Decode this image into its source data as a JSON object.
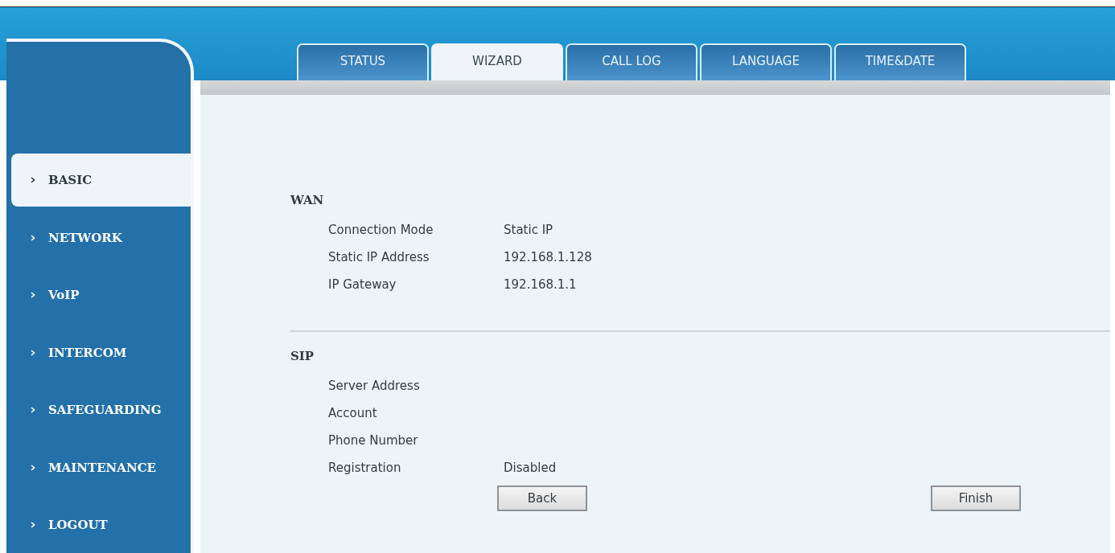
{
  "tabs": [
    {
      "label": "STATUS",
      "selected": false
    },
    {
      "label": "WIZARD",
      "selected": true
    },
    {
      "label": "CALL LOG",
      "selected": false
    },
    {
      "label": "LANGUAGE",
      "selected": false
    },
    {
      "label": "TIME&DATE",
      "selected": false
    }
  ],
  "sidebar": {
    "items": [
      {
        "label": "BASIC",
        "selected": true
      },
      {
        "label": "NETWORK",
        "selected": false
      },
      {
        "label": "VoIP",
        "selected": false
      },
      {
        "label": "INTERCOM",
        "selected": false
      },
      {
        "label": "SAFEGUARDING",
        "selected": false
      },
      {
        "label": "MAINTENANCE",
        "selected": false
      },
      {
        "label": "LOGOUT",
        "selected": false
      }
    ]
  },
  "sections": [
    {
      "title": "WAN",
      "rows": [
        {
          "label": "Connection Mode",
          "value": "Static IP"
        },
        {
          "label": "Static IP Address",
          "value": "192.168.1.128"
        },
        {
          "label": "IP Gateway",
          "value": "192.168.1.1"
        }
      ]
    },
    {
      "title": "SIP",
      "rows": [
        {
          "label": "Server Address"
        },
        {
          "label": "Account"
        },
        {
          "label": "Phone Number"
        },
        {
          "label": "Registration",
          "value": "Disabled"
        }
      ]
    }
  ],
  "buttons": [
    "Back",
    "Finish"
  ]
}
